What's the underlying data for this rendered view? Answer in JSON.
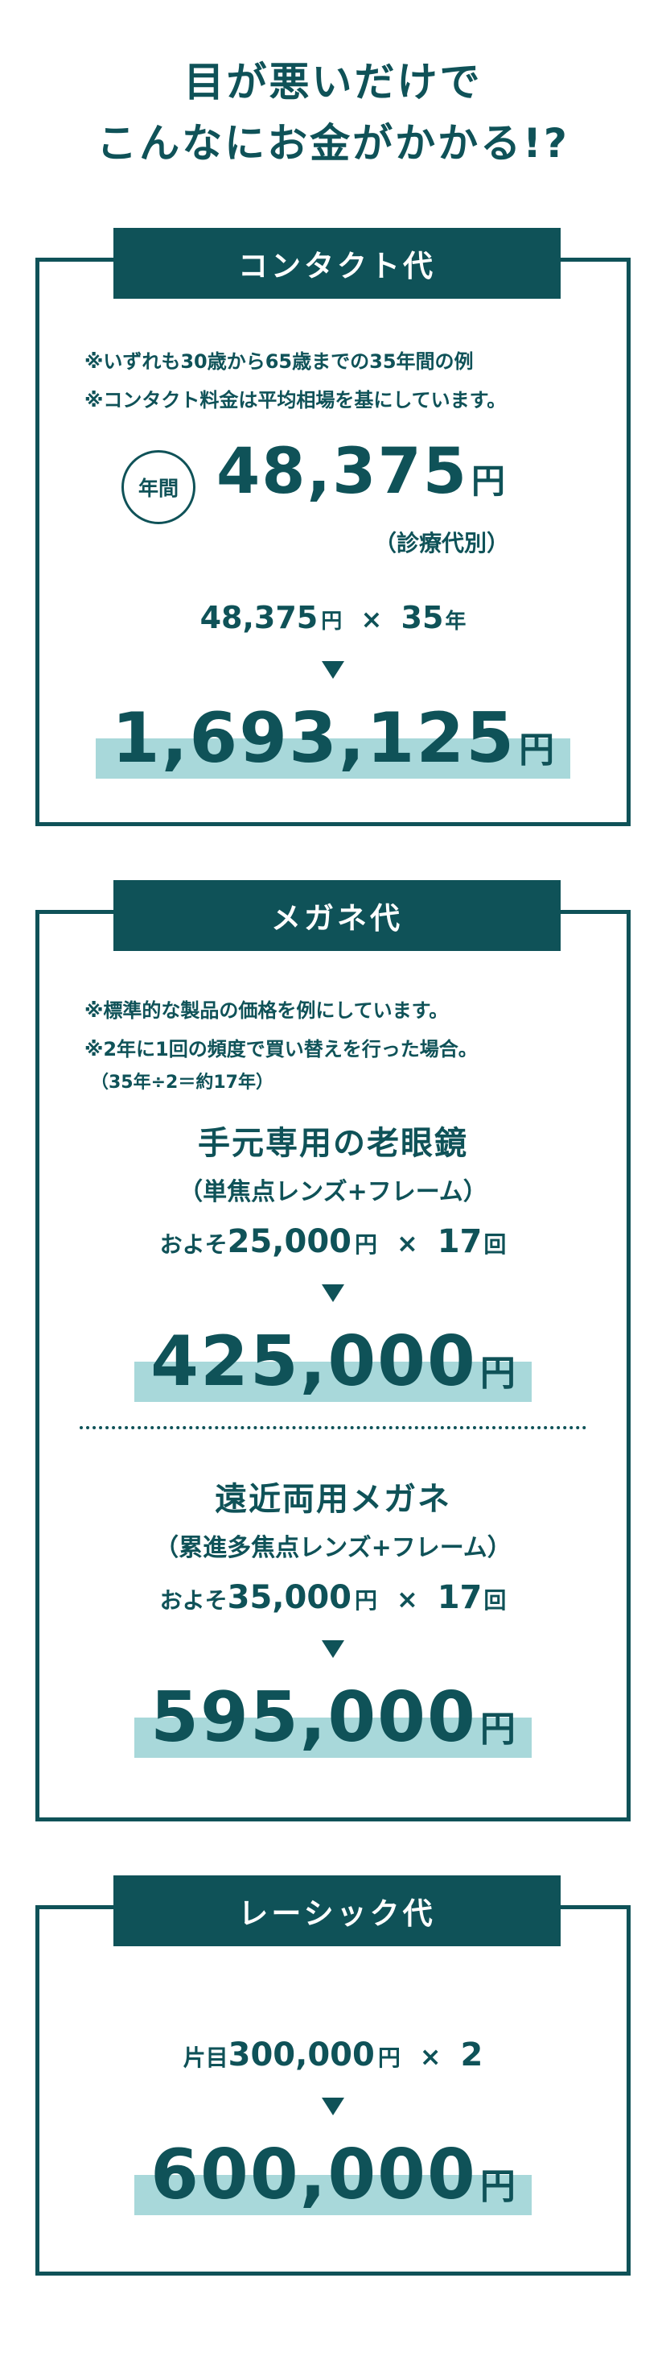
{
  "headline": {
    "line1": "目が悪いだけで",
    "line2": "こんなにお金がかかる!?"
  },
  "contact": {
    "title": "コンタクト代",
    "note1": "※いずれも30歳から65歳までの35年間の例",
    "note2": "※コンタクト料金は平均相場を基にしています。",
    "badge": "年間",
    "annual_num": "48,375",
    "annual_yen": "円",
    "annual_note": "（診療代別）",
    "formula_num": "48,375",
    "formula_yen": "円",
    "formula_times": "×",
    "formula_years": "35",
    "formula_years_unit": "年",
    "total_num": "1,693,125",
    "total_yen": "円"
  },
  "glasses": {
    "title": "メガネ代",
    "note1": "※標準的な製品の価格を例にしています。",
    "note2": "※2年に1回の頻度で買い替えを行った場合。",
    "note3": "（35年÷2＝約17年）",
    "reading_title": "手元専用の老眼鏡",
    "reading_sub": "（単焦点レンズ+フレーム）",
    "reading_prefix": "およそ",
    "reading_num": "25,000",
    "reading_yen": "円",
    "reading_times": "×",
    "reading_count": "17",
    "reading_count_unit": "回",
    "reading_total_num": "425,000",
    "reading_total_yen": "円",
    "progressive_title": "遠近両用メガネ",
    "progressive_sub": "（累進多焦点レンズ+フレーム）",
    "progressive_prefix": "およそ",
    "progressive_num": "35,000",
    "progressive_yen": "円",
    "progressive_times": "×",
    "progressive_count": "17",
    "progressive_count_unit": "回",
    "progressive_total_num": "595,000",
    "progressive_total_yen": "円"
  },
  "lasik": {
    "title": "レーシック代",
    "prefix": "片目",
    "num": "300,000",
    "yen": "円",
    "times": "×",
    "count": "2",
    "total_num": "600,000",
    "total_yen": "円"
  },
  "colors": {
    "primary": "#0f5258",
    "highlight": "#a8d8da"
  }
}
